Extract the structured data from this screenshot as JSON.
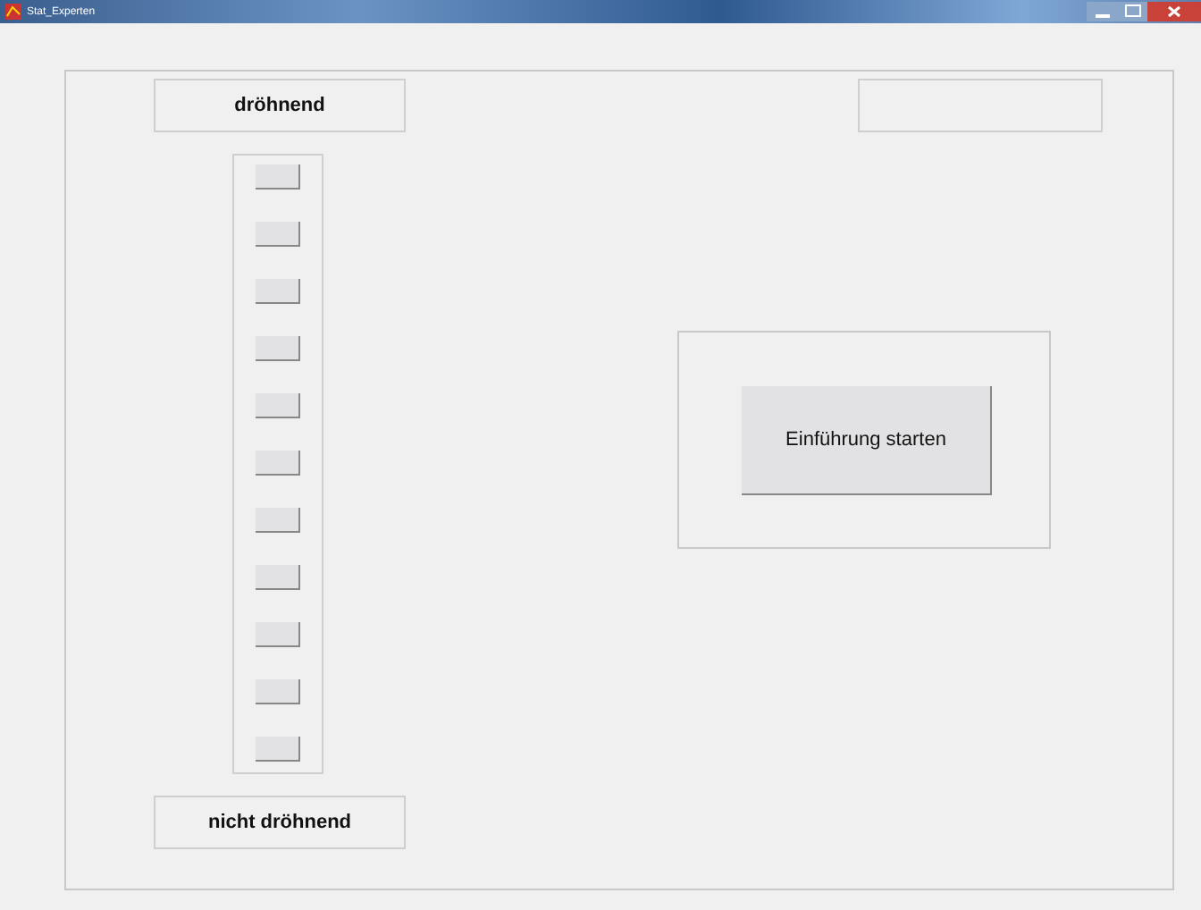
{
  "window": {
    "title": "Stat_Experten"
  },
  "top_label": "dröhnend",
  "status_box": {
    "kind": "empty"
  },
  "scale_buttons": [
    {
      "kind": "button"
    },
    {
      "kind": "button"
    },
    {
      "kind": "button"
    },
    {
      "kind": "button"
    },
    {
      "kind": "button"
    },
    {
      "kind": "button"
    },
    {
      "kind": "button"
    },
    {
      "kind": "button"
    },
    {
      "kind": "button"
    },
    {
      "kind": "button"
    },
    {
      "kind": "button"
    }
  ],
  "bottom_label": "nicht dröhnend",
  "start_button": "Einführung starten"
}
